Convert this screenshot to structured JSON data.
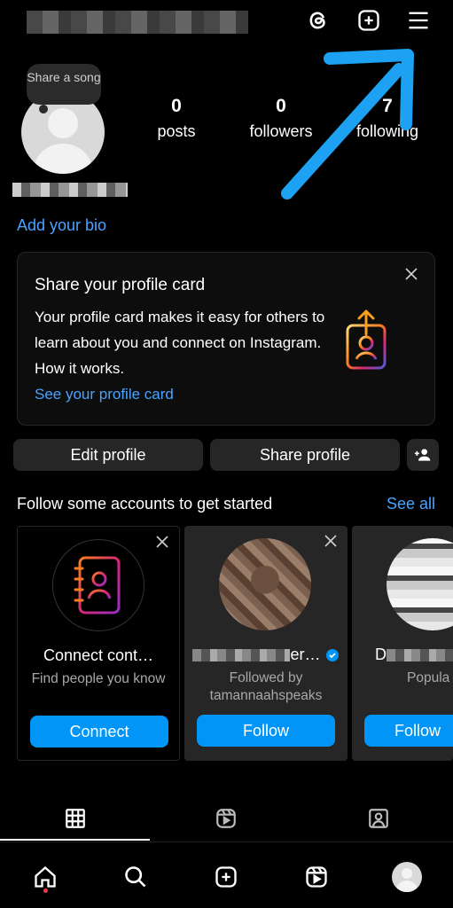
{
  "header": {
    "icons": [
      "threads-icon",
      "create-icon",
      "menu-icon"
    ]
  },
  "profile": {
    "note": "Share a song",
    "stats": [
      {
        "value": "0",
        "label": "posts"
      },
      {
        "value": "0",
        "label": "followers"
      },
      {
        "value": "7",
        "label": "following"
      }
    ],
    "add_bio": "Add your bio"
  },
  "profile_card": {
    "title": "Share your profile card",
    "body": "Your profile card makes it easy for others to learn about you and connect on Instagram. How it works.",
    "link": "See your profile card"
  },
  "actions": {
    "edit": "Edit profile",
    "share": "Share profile"
  },
  "suggestions": {
    "title": "Follow some accounts to get started",
    "see_all": "See all",
    "cards": [
      {
        "title": "Connect cont…",
        "sub": "Find people you know",
        "cta": "Connect"
      },
      {
        "title": "er…",
        "sub": "Followed by tamannaahspeaks",
        "cta": "Follow",
        "verified": true
      },
      {
        "title": "D",
        "sub": "Popula",
        "cta": "Follow"
      }
    ]
  },
  "colors": {
    "accent": "#0095f6",
    "link": "#4aa3ff",
    "annotation_arrow": "#1da1f2"
  }
}
